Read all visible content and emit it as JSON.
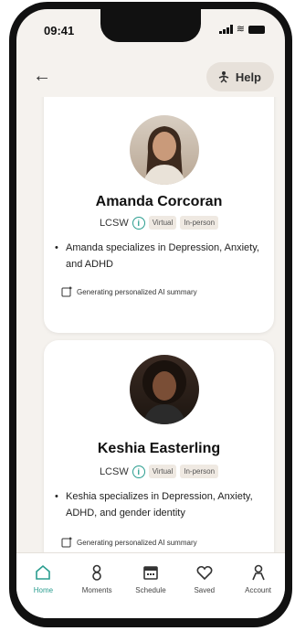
{
  "status_bar": {
    "time": "09:41"
  },
  "header": {
    "help_label": "Help"
  },
  "therapists": [
    {
      "name": "Amanda Corcoran",
      "credential": "LCSW",
      "tags": [
        "Virtual",
        "In-person"
      ],
      "specialty_text": "Amanda specializes in Depression, Anxiety, and ADHD",
      "ai_status": "Generating personalized AI summary"
    },
    {
      "name": "Keshia Easterling",
      "credential": "LCSW",
      "tags": [
        "Virtual",
        "In-person"
      ],
      "specialty_text": "Keshia specializes in Depression, Anxiety, ADHD, and gender identity",
      "ai_status": "Generating personalized AI summary"
    }
  ],
  "tabs": [
    {
      "label": "Home",
      "icon": "home-icon",
      "active": true
    },
    {
      "label": "Moments",
      "icon": "moments-icon",
      "active": false
    },
    {
      "label": "Schedule",
      "icon": "calendar-icon",
      "active": false
    },
    {
      "label": "Saved",
      "icon": "heart-icon",
      "active": false
    },
    {
      "label": "Account",
      "icon": "account-icon",
      "active": false
    }
  ],
  "colors": {
    "accent": "#2a9d8f",
    "background": "#f5f2ee"
  }
}
